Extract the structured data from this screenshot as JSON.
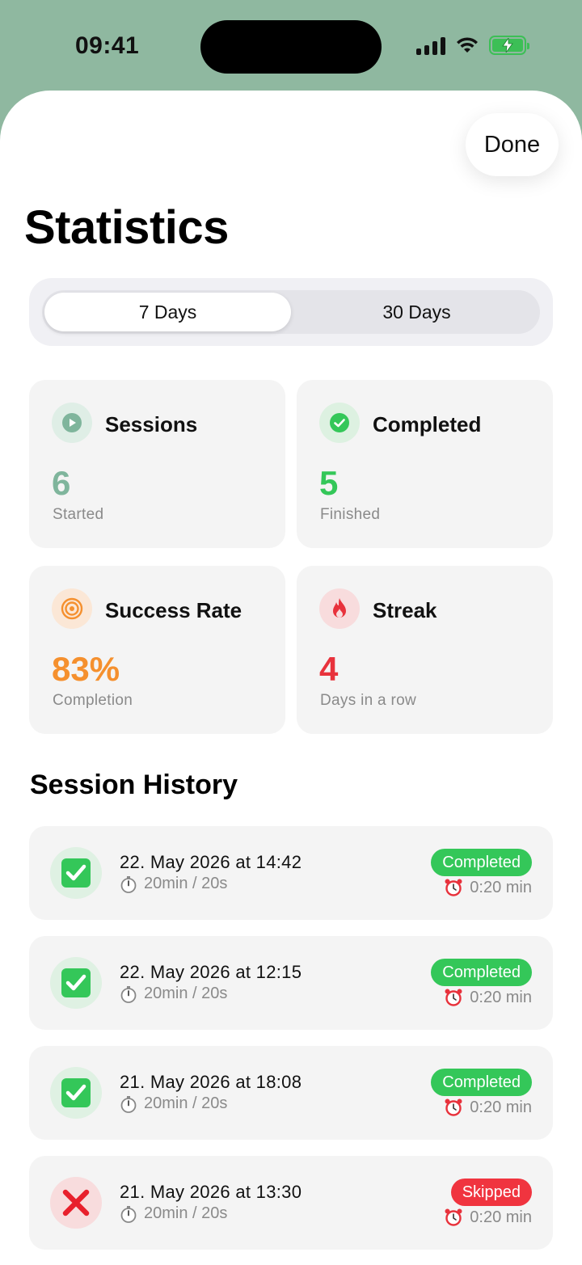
{
  "status_bar": {
    "time": "09:41"
  },
  "header": {
    "done_label": "Done",
    "title": "Statistics"
  },
  "segments": [
    {
      "label": "7 Days",
      "active": true
    },
    {
      "label": "30 Days",
      "active": false
    }
  ],
  "stats": [
    {
      "title": "Sessions",
      "value": "6",
      "subtitle": "Started",
      "icon": "play-icon",
      "color": "#7fb59c"
    },
    {
      "title": "Completed",
      "value": "5",
      "subtitle": "Finished",
      "icon": "check-circle-icon",
      "color": "#34c759"
    },
    {
      "title": "Success Rate",
      "value": "83%",
      "subtitle": "Completion",
      "icon": "target-icon",
      "color": "#f5902e"
    },
    {
      "title": "Streak",
      "value": "4",
      "subtitle": "Days in a row",
      "icon": "flame-icon",
      "color": "#e8323c"
    }
  ],
  "history": {
    "title": "Session History",
    "items": [
      {
        "date": "22. May 2026 at 14:42",
        "duration": "20min / 20s",
        "status": "Completed",
        "time": "0:20 min",
        "icon": "checkmark-box-icon"
      },
      {
        "date": "22. May 2026 at 12:15",
        "duration": "20min / 20s",
        "status": "Completed",
        "time": "0:20 min",
        "icon": "checkmark-box-icon"
      },
      {
        "date": "21. May 2026 at 18:08",
        "duration": "20min / 20s",
        "status": "Completed",
        "time": "0:20 min",
        "icon": "checkmark-box-icon"
      },
      {
        "date": "21. May 2026 at 13:30",
        "duration": "20min / 20s",
        "status": "Skipped",
        "time": "0:20 min",
        "icon": "cross-mark-icon"
      }
    ]
  },
  "colors": {
    "completed": "#34c759",
    "skipped": "#f0343f",
    "background": "#8fb8a0"
  }
}
